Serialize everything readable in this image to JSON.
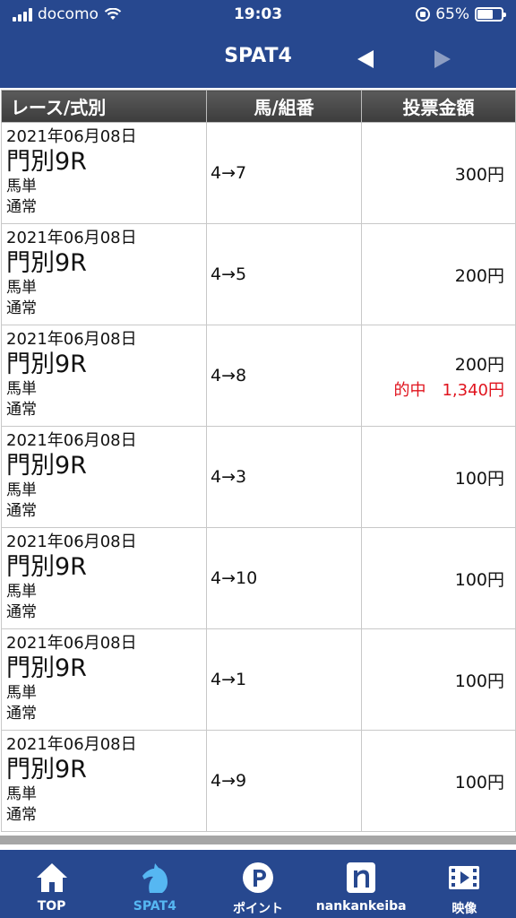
{
  "status": {
    "carrier": "docomo",
    "time": "19:03",
    "battery": "65%",
    "battery_level": 0.65
  },
  "header": {
    "title": "SPAT4"
  },
  "table": {
    "columns": [
      "レース/式別",
      "馬/組番",
      "投票金額"
    ],
    "rows": [
      {
        "date": "2021年06月08日",
        "race": "門別9R",
        "bet_type": "馬単",
        "mode": "通常",
        "combo": "4→7",
        "amount": "300円",
        "hit": ""
      },
      {
        "date": "2021年06月08日",
        "race": "門別9R",
        "bet_type": "馬単",
        "mode": "通常",
        "combo": "4→5",
        "amount": "200円",
        "hit": ""
      },
      {
        "date": "2021年06月08日",
        "race": "門別9R",
        "bet_type": "馬単",
        "mode": "通常",
        "combo": "4→8",
        "amount": "200円",
        "hit": "的中　1,340円"
      },
      {
        "date": "2021年06月08日",
        "race": "門別9R",
        "bet_type": "馬単",
        "mode": "通常",
        "combo": "4→3",
        "amount": "100円",
        "hit": ""
      },
      {
        "date": "2021年06月08日",
        "race": "門別9R",
        "bet_type": "馬単",
        "mode": "通常",
        "combo": "4→10",
        "amount": "100円",
        "hit": ""
      },
      {
        "date": "2021年06月08日",
        "race": "門別9R",
        "bet_type": "馬単",
        "mode": "通常",
        "combo": "4→1",
        "amount": "100円",
        "hit": ""
      },
      {
        "date": "2021年06月08日",
        "race": "門別9R",
        "bet_type": "馬単",
        "mode": "通常",
        "combo": "4→9",
        "amount": "100円",
        "hit": ""
      }
    ]
  },
  "tabs": [
    {
      "label": "TOP",
      "icon": "home-icon"
    },
    {
      "label": "SPAT4",
      "icon": "horse-icon",
      "active": true
    },
    {
      "label": "ポイント",
      "icon": "point-icon"
    },
    {
      "label": "nankankeiba",
      "icon": "n-logo-icon"
    },
    {
      "label": "映像",
      "icon": "video-icon"
    }
  ],
  "colors": {
    "header_bg": "#27488f",
    "active_tab": "#56b7f2",
    "hit_text": "#e0141e"
  }
}
